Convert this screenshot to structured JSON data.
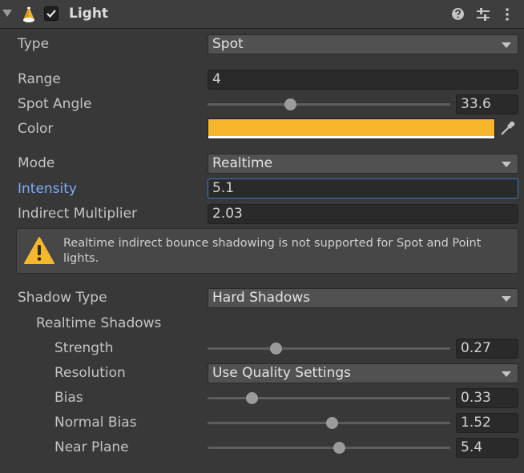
{
  "header": {
    "title": "Light",
    "enabled": true,
    "icons": [
      "foldout-triangle-icon",
      "light-icon",
      "checkbox-check-icon",
      "help-icon",
      "preset-icon",
      "menu-icon"
    ]
  },
  "fields": {
    "type": {
      "label": "Type",
      "value": "Spot"
    },
    "range": {
      "label": "Range",
      "value": "4"
    },
    "spot_angle": {
      "label": "Spot Angle",
      "value": "33.6",
      "slider_fraction": 0.34
    },
    "color": {
      "label": "Color",
      "value": "#f7b52c"
    },
    "mode": {
      "label": "Mode",
      "value": "Realtime"
    },
    "intensity": {
      "label": "Intensity",
      "value": "5.1"
    },
    "indirect_multiplier": {
      "label": "Indirect Multiplier",
      "value": "2.03"
    },
    "warning": {
      "text": "Realtime indirect bounce shadowing is not supported for Spot and Point lights."
    },
    "shadow_type": {
      "label": "Shadow Type",
      "value": "Hard Shadows"
    },
    "realtime_shadows": {
      "label": "Realtime Shadows"
    },
    "strength": {
      "label": "Strength",
      "value": "0.27",
      "slider_fraction": 0.28
    },
    "resolution": {
      "label": "Resolution",
      "value": "Use Quality Settings"
    },
    "bias": {
      "label": "Bias",
      "value": "0.33",
      "slider_fraction": 0.18
    },
    "normal_bias": {
      "label": "Normal Bias",
      "value": "1.52",
      "slider_fraction": 0.51
    },
    "near_plane": {
      "label": "Near Plane",
      "value": "5.4",
      "slider_fraction": 0.54
    }
  },
  "colors": {
    "accent_focus": "#3a79bb",
    "active_label": "#7cacf8",
    "light_color": "#f7b52c",
    "warning_yellow": "#f5b82a"
  }
}
